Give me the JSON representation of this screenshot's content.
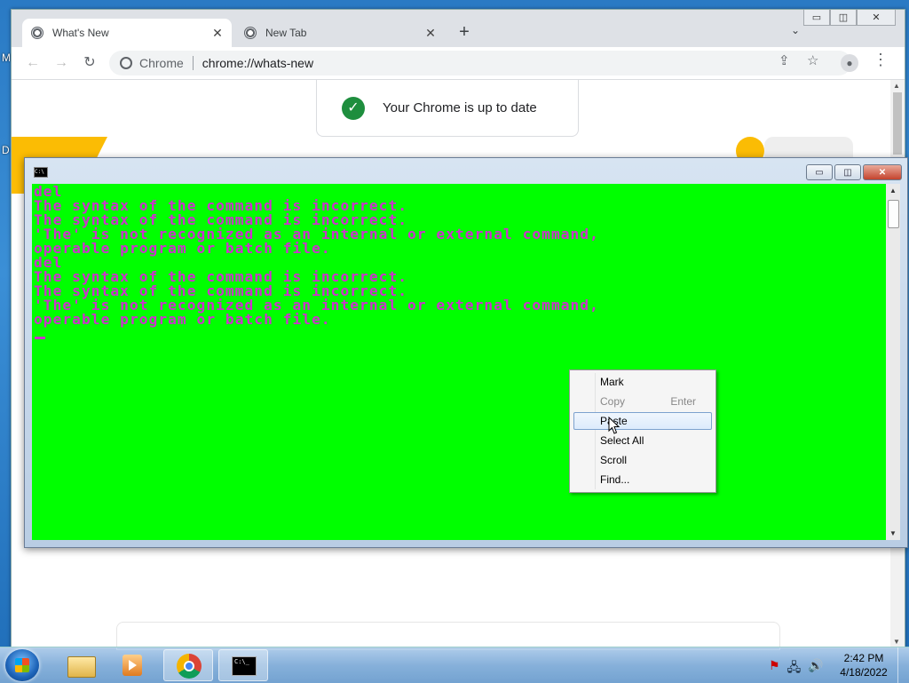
{
  "desktop": {
    "label1": "M",
    "label2": "D"
  },
  "chrome": {
    "tabs": [
      {
        "label": "What's New",
        "close": "✕"
      },
      {
        "label": "New Tab",
        "close": "✕"
      }
    ],
    "new_tab": "+",
    "tab_search": "⌄",
    "window_controls": {
      "minimize": "▭",
      "maximize": "◫",
      "close": "✕"
    },
    "nav": {
      "back": "←",
      "forward": "→",
      "reload": "↻"
    },
    "omnibox": {
      "site": "Chrome",
      "url": "chrome://whats-new"
    },
    "toolbar_right": {
      "share": "⇪",
      "bookmark": "☆",
      "profile": "●",
      "menu": "⋮"
    },
    "page": {
      "status_text": "Your Chrome is up to date",
      "check": "✓"
    }
  },
  "cmd": {
    "icon_text": "C:\\",
    "controls": {
      "minimize": "▭",
      "maximize": "◫",
      "close": "✕"
    },
    "output": "del\nThe syntax of the command is incorrect.\nThe syntax of the command is incorrect.\n'The' is not recognized as an internal or external command,\noperable program or batch file.\ndel\nThe syntax of the command is incorrect.\nThe syntax of the command is incorrect.\n'The' is not recognized as an internal or external command,\noperable program or batch file."
  },
  "context_menu": {
    "items": [
      {
        "label": "Mark",
        "accel": "",
        "disabled": false
      },
      {
        "label": "Copy",
        "accel": "Enter",
        "disabled": true
      },
      {
        "label": "Paste",
        "accel": "",
        "disabled": false,
        "highlighted": true
      },
      {
        "label": "Select All",
        "accel": "",
        "disabled": false
      },
      {
        "label": "Scroll",
        "accel": "",
        "disabled": false
      },
      {
        "label": "Find...",
        "accel": "",
        "disabled": false
      }
    ]
  },
  "taskbar": {
    "cmd_icon_text": "C:\\_",
    "tray": {
      "flag": "⚑",
      "network": "🖧",
      "volume": "🔊"
    },
    "time": "2:42 PM",
    "date": "4/18/2022"
  }
}
